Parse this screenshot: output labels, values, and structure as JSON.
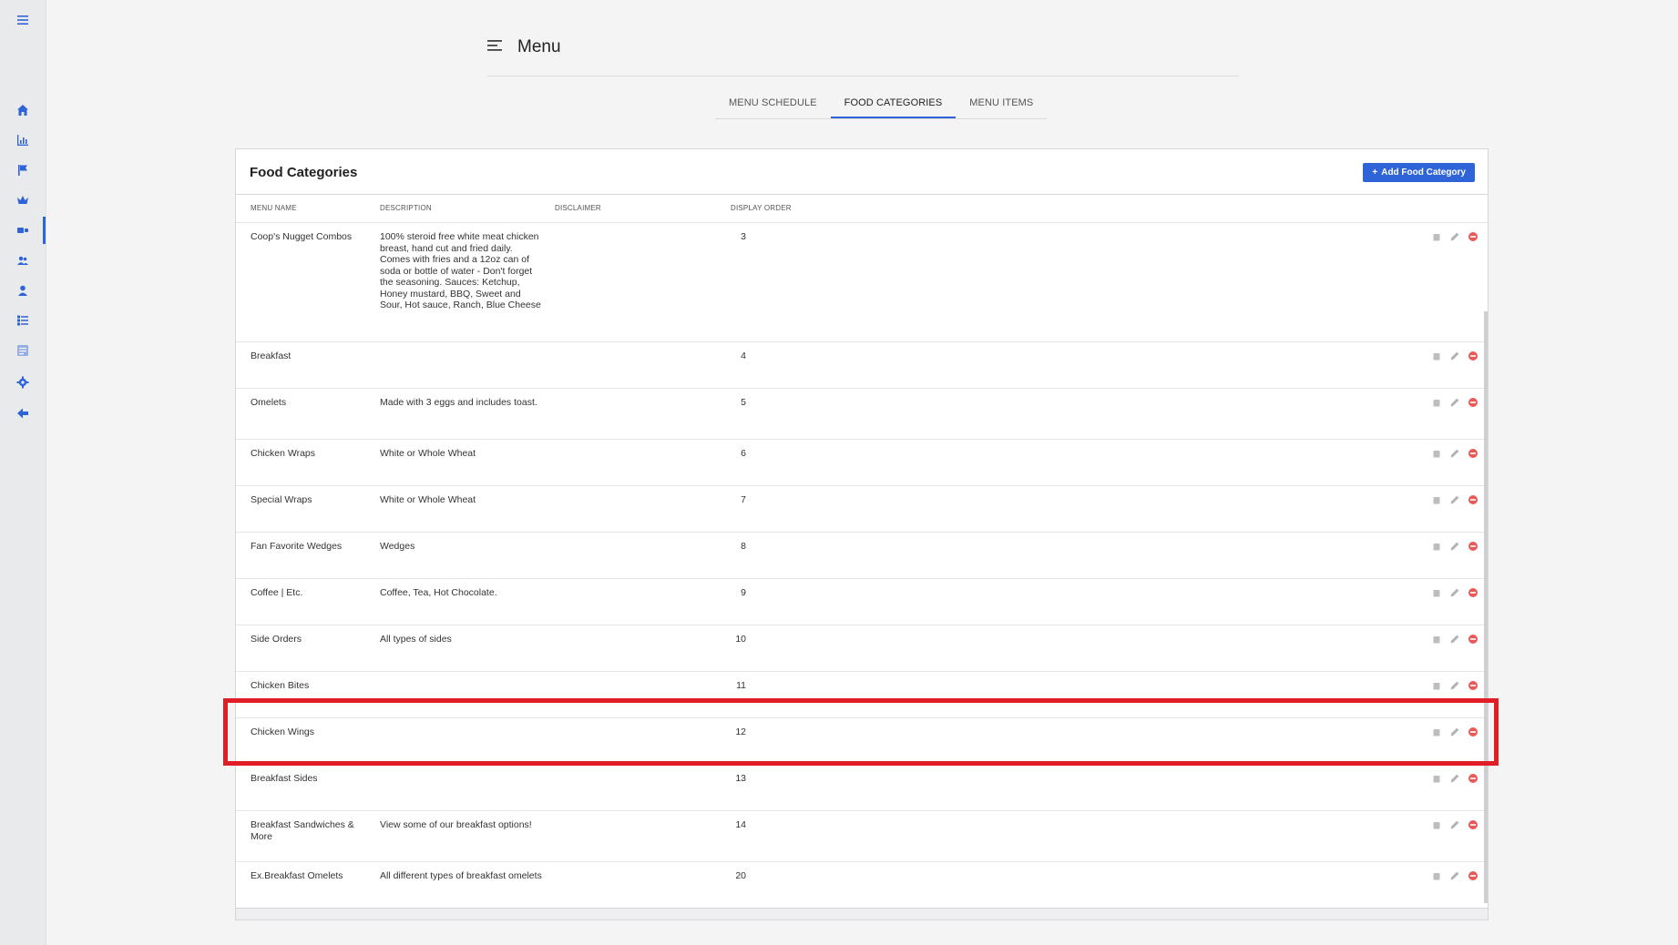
{
  "header": {
    "title": "Menu"
  },
  "tabs": [
    {
      "label": "MENU SCHEDULE",
      "active": false
    },
    {
      "label": "FOOD CATEGORIES",
      "active": true
    },
    {
      "label": "MENU ITEMS",
      "active": false
    }
  ],
  "card": {
    "title": "Food Categories",
    "add_button_label": "Add Food Category",
    "add_button_prefix": "+"
  },
  "table": {
    "columns": [
      "MENU NAME",
      "DESCRIPTION",
      "DISCLAIMER",
      "DISPLAY ORDER"
    ],
    "rows": [
      {
        "name": "Coop's Nugget Combos",
        "description": "100% steroid free white meat chicken breast, hand cut and fried daily. Comes with fries and a 12oz can of soda or bottle of water - Don't forget the seasoning. Sauces: Ketchup, Honey mustard, BBQ, Sweet and Sour, Hot sauce, Ranch, Blue Cheese",
        "disclaimer": "",
        "order": "3"
      },
      {
        "name": "Breakfast",
        "description": "",
        "disclaimer": "",
        "order": "4"
      },
      {
        "name": "Omelets",
        "description": "Made with 3 eggs and includes toast.",
        "disclaimer": "",
        "order": "5"
      },
      {
        "name": "Chicken Wraps",
        "description": "White or Whole Wheat",
        "disclaimer": "",
        "order": "6"
      },
      {
        "name": "Special Wraps",
        "description": "White or Whole Wheat",
        "disclaimer": "",
        "order": "7"
      },
      {
        "name": "Fan Favorite Wedges",
        "description": "Wedges",
        "disclaimer": "",
        "order": "8"
      },
      {
        "name": "Coffee | Etc.",
        "description": "Coffee, Tea, Hot Chocolate.",
        "disclaimer": "",
        "order": "9"
      },
      {
        "name": "Side Orders",
        "description": "All types of sides",
        "disclaimer": "",
        "order": "10"
      },
      {
        "name": "Chicken Bites",
        "description": "",
        "disclaimer": "",
        "order": "11"
      },
      {
        "name": "Chicken Wings",
        "description": "",
        "disclaimer": "",
        "order": "12"
      },
      {
        "name": "Breakfast Sides",
        "description": "",
        "disclaimer": "",
        "order": "13"
      },
      {
        "name": "Breakfast Sandwiches & More",
        "description": "View some of our breakfast options!",
        "disclaimer": "",
        "order": "14"
      },
      {
        "name": "Ex.Breakfast Omelets",
        "description": "All different types of breakfast omelets",
        "disclaimer": "",
        "order": "20"
      }
    ]
  },
  "sidebar": {
    "icons": [
      "menu-icon",
      "home-icon",
      "chart-icon",
      "flag-icon",
      "crown-icon",
      "tag-icon",
      "users-icon",
      "person-icon",
      "list-icon",
      "report-icon",
      "settings-icon",
      "back-arrow-icon"
    ],
    "active_index": 5
  },
  "colors": {
    "accent": "#2f63d8",
    "danger": "#e85a5a",
    "highlight": "#e01c24"
  },
  "highlight_row_index": 9
}
